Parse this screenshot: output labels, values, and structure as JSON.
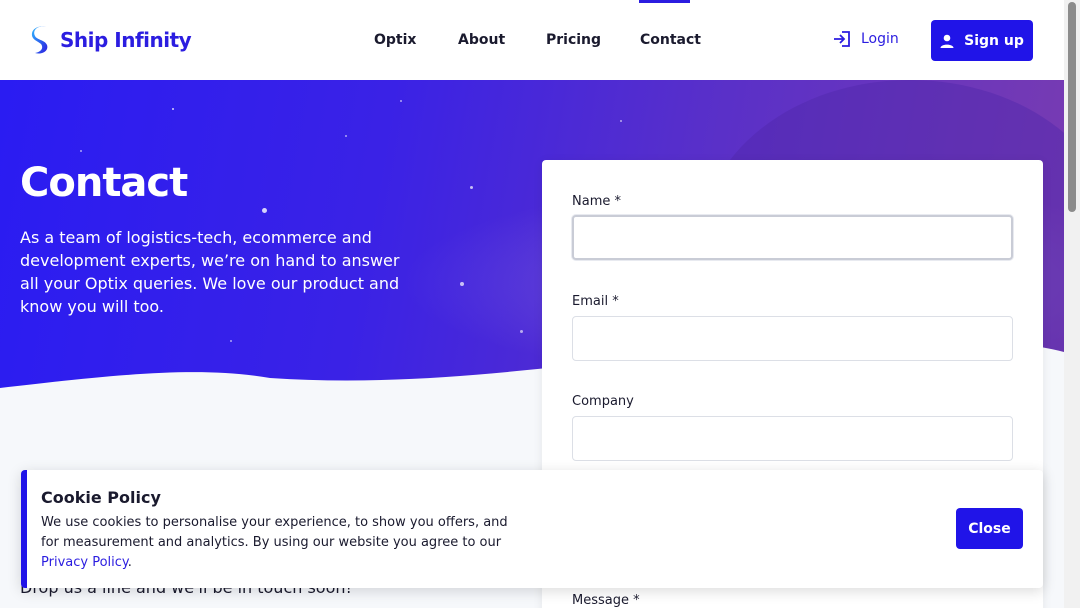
{
  "brand": {
    "name": "Ship Infinity"
  },
  "nav": {
    "items": [
      "Optix",
      "About",
      "Pricing",
      "Contact"
    ],
    "active": "Contact"
  },
  "auth": {
    "login": "Login",
    "signup": "Sign up"
  },
  "hero": {
    "title": "Contact",
    "body": "As a team of logistics-tech, ecommerce and development experts, we’re on hand to answer all your Optix queries. We love our product and know you will too."
  },
  "form": {
    "name_label": "Name *",
    "email_label": "Email *",
    "company_label": "Company",
    "message_label": "Message *"
  },
  "dropline": "Drop us a line and we'll be in touch soon!",
  "cookie": {
    "title": "Cookie Policy",
    "text": "We use cookies to personalise your experience, to show you offers, and for measurement and analytics. By using our website you agree to our",
    "link": "Privacy Policy",
    "close": "Close"
  },
  "colors": {
    "accent": "#2014e8",
    "hero_start": "#2a1cf2",
    "hero_end": "#7a3cb0"
  }
}
